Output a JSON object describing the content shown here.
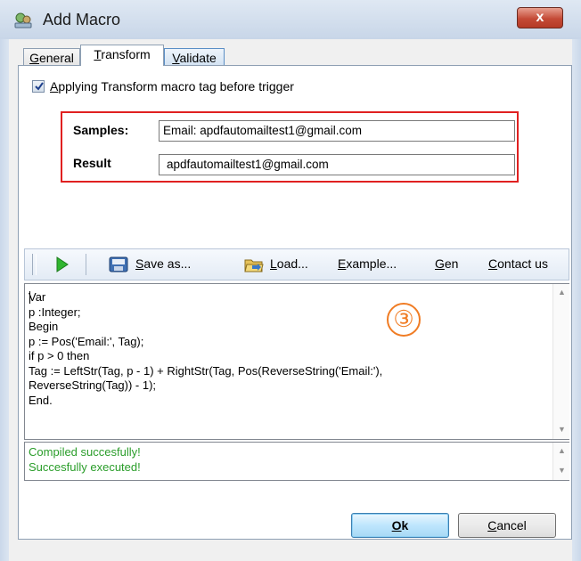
{
  "window": {
    "title": "Add Macro",
    "close_label": "x"
  },
  "tabs": [
    {
      "label": "General",
      "underline": "G",
      "rest": "eneral"
    },
    {
      "label": "Transform",
      "underline": "T",
      "rest": "ransform"
    },
    {
      "label": "Validate",
      "underline": "V",
      "rest": "alidate"
    }
  ],
  "active_tab": "Transform",
  "options": {
    "apply_transform_checked": true,
    "apply_transform_pre": "A",
    "apply_transform_label": "pplying Transform macro tag before trigger"
  },
  "samples": {
    "label": "Samples:",
    "value": "Email: apdfautomailtest1@gmail.com"
  },
  "result": {
    "label": "Result",
    "value": "apdfautomailtest1@gmail.com"
  },
  "toolbar": {
    "run_icon": "play-icon",
    "save_u": "S",
    "save_rest": "ave as...",
    "save_icon": "save-icon",
    "load_u": "L",
    "load_rest": "oad...",
    "load_icon": "folder-open-icon",
    "example_u": "E",
    "example_rest": "xample...",
    "gen_u": "G",
    "gen_rest": "en",
    "contact_u": "C",
    "contact_rest": "ontact us"
  },
  "code": "Var\np :Integer;\nBegin\np := Pos('Email:', Tag);\nif p > 0 then\nTag := LeftStr(Tag, p - 1) + RightStr(Tag, Pos(ReverseString('Email:'),\nReverseString(Tag)) - 1);\nEnd.",
  "annotation_marker": "③",
  "output": [
    "Compiled succesfully!",
    "Succesfully executed!"
  ],
  "buttons": {
    "ok_u": "O",
    "ok_rest": "k",
    "cancel_u": "C",
    "cancel_rest": "ancel"
  },
  "colors": {
    "highlight_box": "#e02020",
    "output_text": "#2a9d2a",
    "annotation": "#f07c24",
    "run_icon": "#2fb52f"
  }
}
